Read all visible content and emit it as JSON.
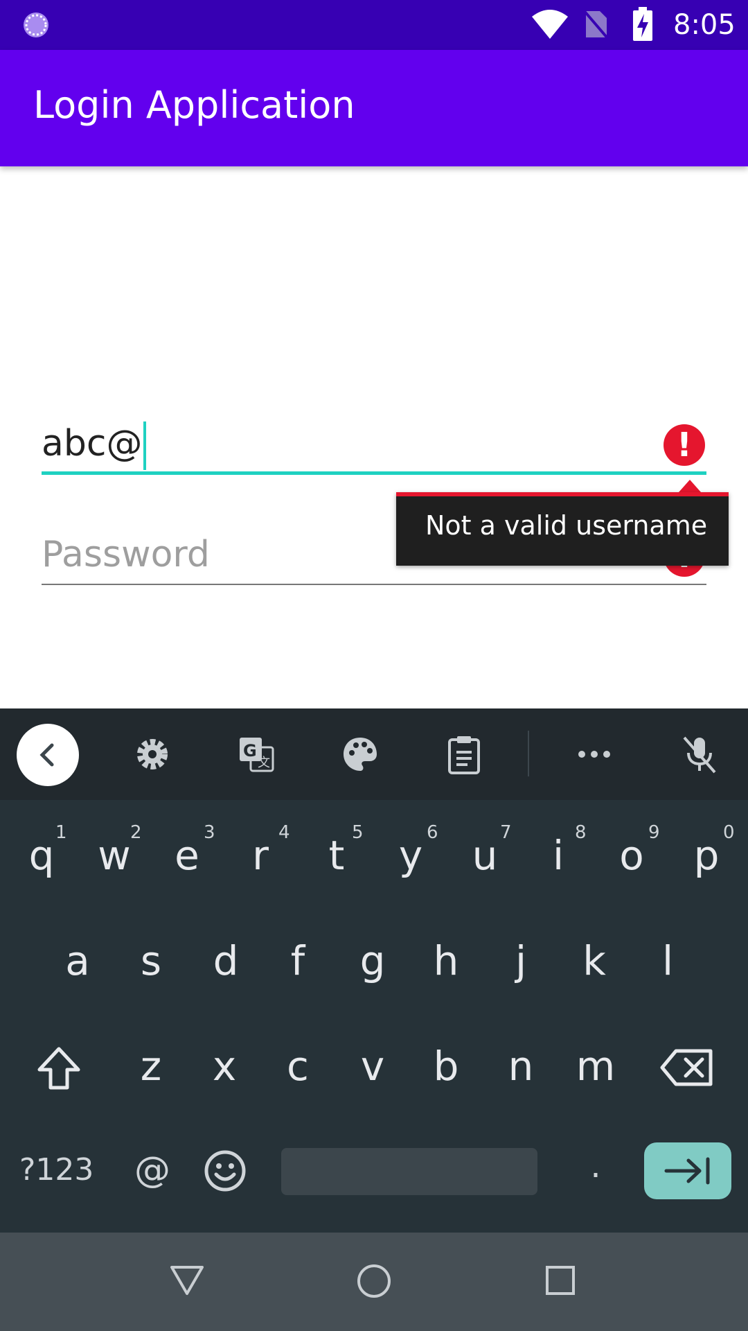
{
  "status_bar": {
    "time": "8:05",
    "icons": [
      "loading-icon",
      "wifi-icon",
      "no-sim-icon",
      "battery-charging-icon"
    ],
    "background": "#3700b3"
  },
  "app_bar": {
    "title": "Login Application",
    "background": "#6200ee"
  },
  "form": {
    "username": {
      "value": "abc@",
      "error_message": "Not a valid username"
    },
    "password": {
      "placeholder": "Password"
    }
  },
  "keyboard": {
    "toolbar_icons": [
      "back-icon",
      "settings-icon",
      "translate-icon",
      "palette-icon",
      "clipboard-icon",
      "more-icon",
      "mic-off-icon"
    ],
    "row1": [
      "q",
      "w",
      "e",
      "r",
      "t",
      "y",
      "u",
      "i",
      "o",
      "p"
    ],
    "row1_hints": [
      "1",
      "2",
      "3",
      "4",
      "5",
      "6",
      "7",
      "8",
      "9",
      "0"
    ],
    "row2": [
      "a",
      "s",
      "d",
      "f",
      "g",
      "h",
      "j",
      "k",
      "l"
    ],
    "row3": [
      "z",
      "x",
      "c",
      "v",
      "b",
      "n",
      "m"
    ],
    "bottom": {
      "symbols": "?123",
      "at": "@",
      "period": "."
    }
  },
  "nav_bar": {
    "icons": [
      "back-triangle-icon",
      "home-circle-icon",
      "recents-square-icon"
    ]
  },
  "colors": {
    "accent": "#1fd1c1",
    "error": "#e5162e",
    "keyboard_bg": "#263238",
    "enter_key": "#80cbc4"
  }
}
